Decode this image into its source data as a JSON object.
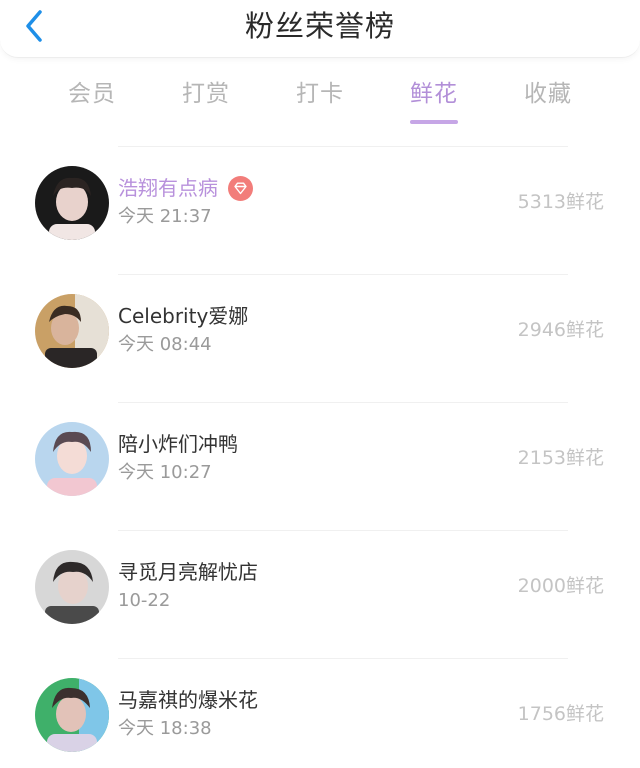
{
  "header": {
    "title": "粉丝荣誉榜",
    "back_icon": "chevron-left-icon",
    "back_color": "#1e8fe8"
  },
  "tabs": [
    {
      "label": "会员",
      "active": false
    },
    {
      "label": "打赏",
      "active": false
    },
    {
      "label": "打卡",
      "active": false
    },
    {
      "label": "鲜花",
      "active": true
    },
    {
      "label": "收藏",
      "active": false
    }
  ],
  "colors": {
    "accent": "#b28fd8",
    "underline": "#c6a6e6",
    "vip_name": "#b891dc",
    "badge": "#f27d7a",
    "muted": "#c4c4c4"
  },
  "ranking": [
    {
      "name": "浩翔有点病",
      "time": "今天 21:37",
      "amount": "5313鲜花",
      "vip": true,
      "badge_icon": "diamond-icon",
      "avatar_bg": "#1a1a1a",
      "avatar_fg": "#e8d2cc"
    },
    {
      "name": "Celebrity爱娜",
      "time": "今天 08:44",
      "amount": "2946鲜花",
      "vip": false,
      "avatar_bg": "#c9a066",
      "avatar_fg": "#3a2c22"
    },
    {
      "name": "陪小炸们冲鸭",
      "time": "今天 10:27",
      "amount": "2153鲜花",
      "vip": false,
      "avatar_bg": "#b9d6ee",
      "avatar_fg": "#f2c7d1"
    },
    {
      "name": "寻觅月亮解忧店",
      "time": "10-22",
      "amount": "2000鲜花",
      "vip": false,
      "avatar_bg": "#d7d7d7",
      "avatar_fg": "#2e2a2a"
    },
    {
      "name": "马嘉祺的爆米花",
      "time": "今天 18:38",
      "amount": "1756鲜花",
      "vip": false,
      "avatar_bg": "#3fb06a",
      "avatar_fg": "#e2c2b8"
    }
  ]
}
